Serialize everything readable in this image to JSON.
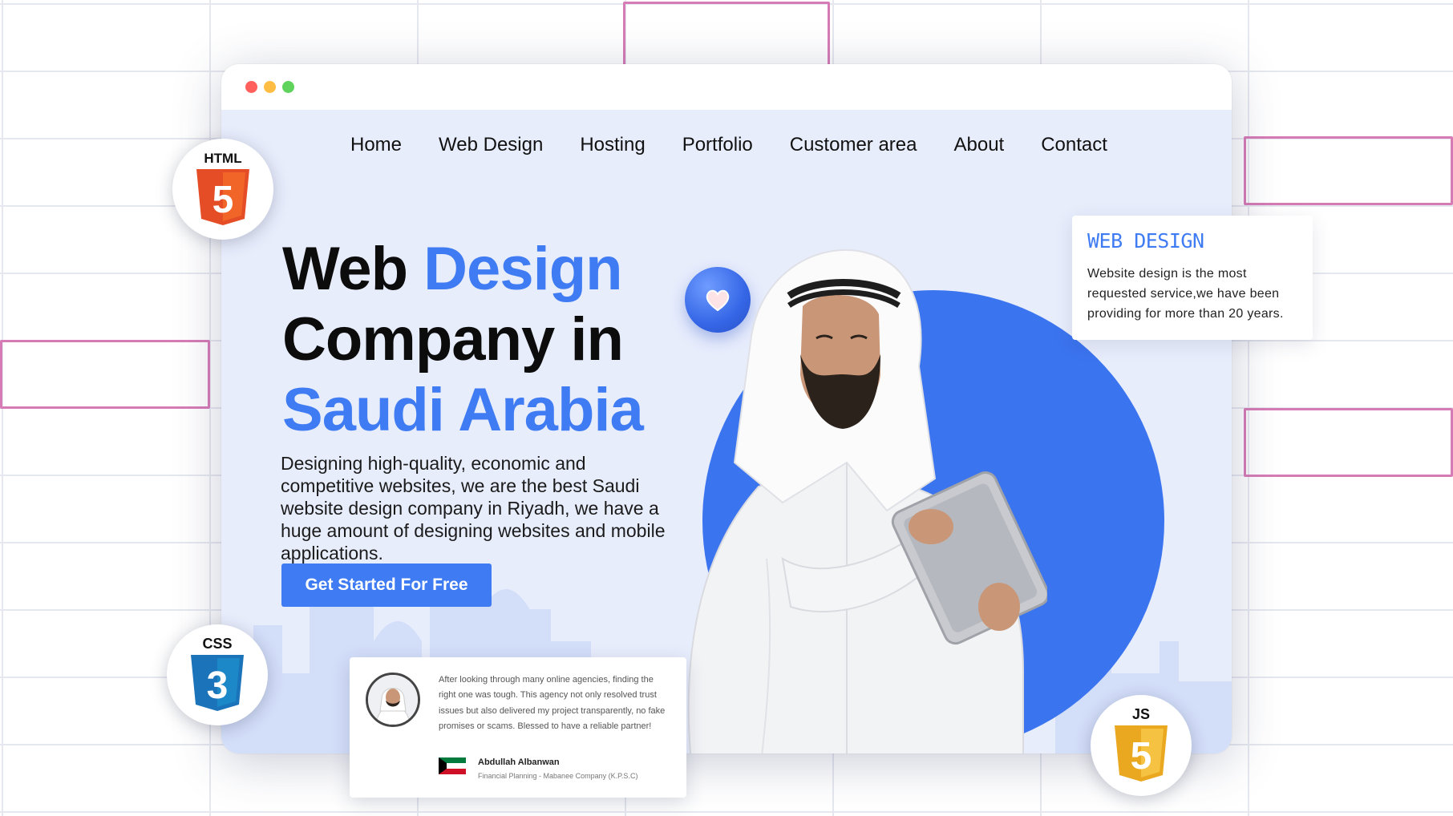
{
  "nav": {
    "items": [
      {
        "label": "Home"
      },
      {
        "label": "Web Design"
      },
      {
        "label": "Hosting"
      },
      {
        "label": "Portfolio"
      },
      {
        "label": "Customer area"
      },
      {
        "label": "About"
      },
      {
        "label": "Contact"
      }
    ]
  },
  "hero": {
    "title_part1": "Web ",
    "title_part2": "Design",
    "title_line2": "Company in",
    "title_line3": "Saudi Arabia",
    "description": "Designing high-quality, economic and competitive websites, we are the best Saudi website design company in Riyadh, we have a huge amount of designing websites and mobile applications.",
    "cta_label": "Get Started For Free"
  },
  "info_card": {
    "heading": "WEB DESIGN",
    "body": "Website design is the most requested service,we have been providing for more than 20 years."
  },
  "testimonial": {
    "text": "After looking through many online agencies, finding the right one was tough. This agency not only resolved trust issues but also delivered my project transparently, no fake promises or scams. Blessed to have a reliable partner!",
    "name": "Abdullah Albanwan",
    "role": "Financial Planning - Mabanee Company (K.P.S.C)"
  },
  "badges": {
    "html": "HTML",
    "html_num": "5",
    "css": "CSS",
    "css_num": "3",
    "js": "JS",
    "js_num": "5"
  },
  "icons": {
    "heart": "heart-icon",
    "html5": "html5-logo-icon",
    "css3": "css3-logo-icon",
    "js": "js-logo-icon",
    "flag": "kuwait-flag-icon"
  },
  "colors": {
    "accent": "#3f7bf2",
    "hero_bg": "#e8edfc",
    "html_orange": "#e44d26",
    "css_blue": "#1b73ba",
    "js_yellow": "#f0b323",
    "dot_red": "#ff605c",
    "dot_yellow": "#ffbd44",
    "dot_green": "#5fd35b"
  }
}
